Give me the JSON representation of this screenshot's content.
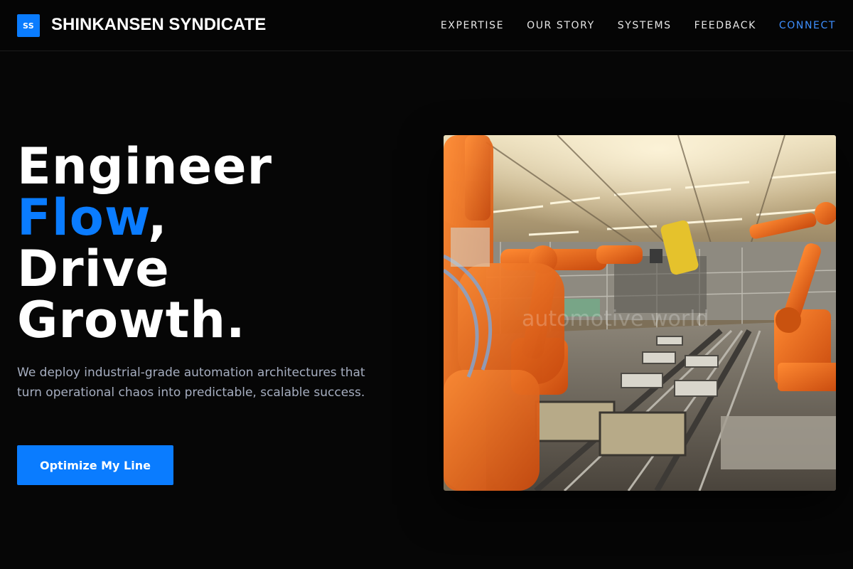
{
  "brand": {
    "logo_text": "SS",
    "name": "SHINKANSEN SYNDICATE"
  },
  "nav": {
    "items": [
      {
        "label": "EXPERTISE"
      },
      {
        "label": "OUR STORY"
      },
      {
        "label": "SYSTEMS"
      },
      {
        "label": "FEEDBACK"
      },
      {
        "label": "CONNECT"
      }
    ]
  },
  "hero": {
    "headline": {
      "line1": "Engineer",
      "line2_highlight": "Flow",
      "line2_rest": ",",
      "line3": "Drive",
      "line4": "Growth."
    },
    "subtext": "We deploy industrial-grade automation architectures that turn operational chaos into predictable, scalable success.",
    "cta_label": "Optimize My Line",
    "image_watermark": "automotive world"
  },
  "colors": {
    "accent": "#0a7cff",
    "background": "#060606",
    "subtext": "#a6aec0",
    "robot_orange": "#e8641c"
  }
}
